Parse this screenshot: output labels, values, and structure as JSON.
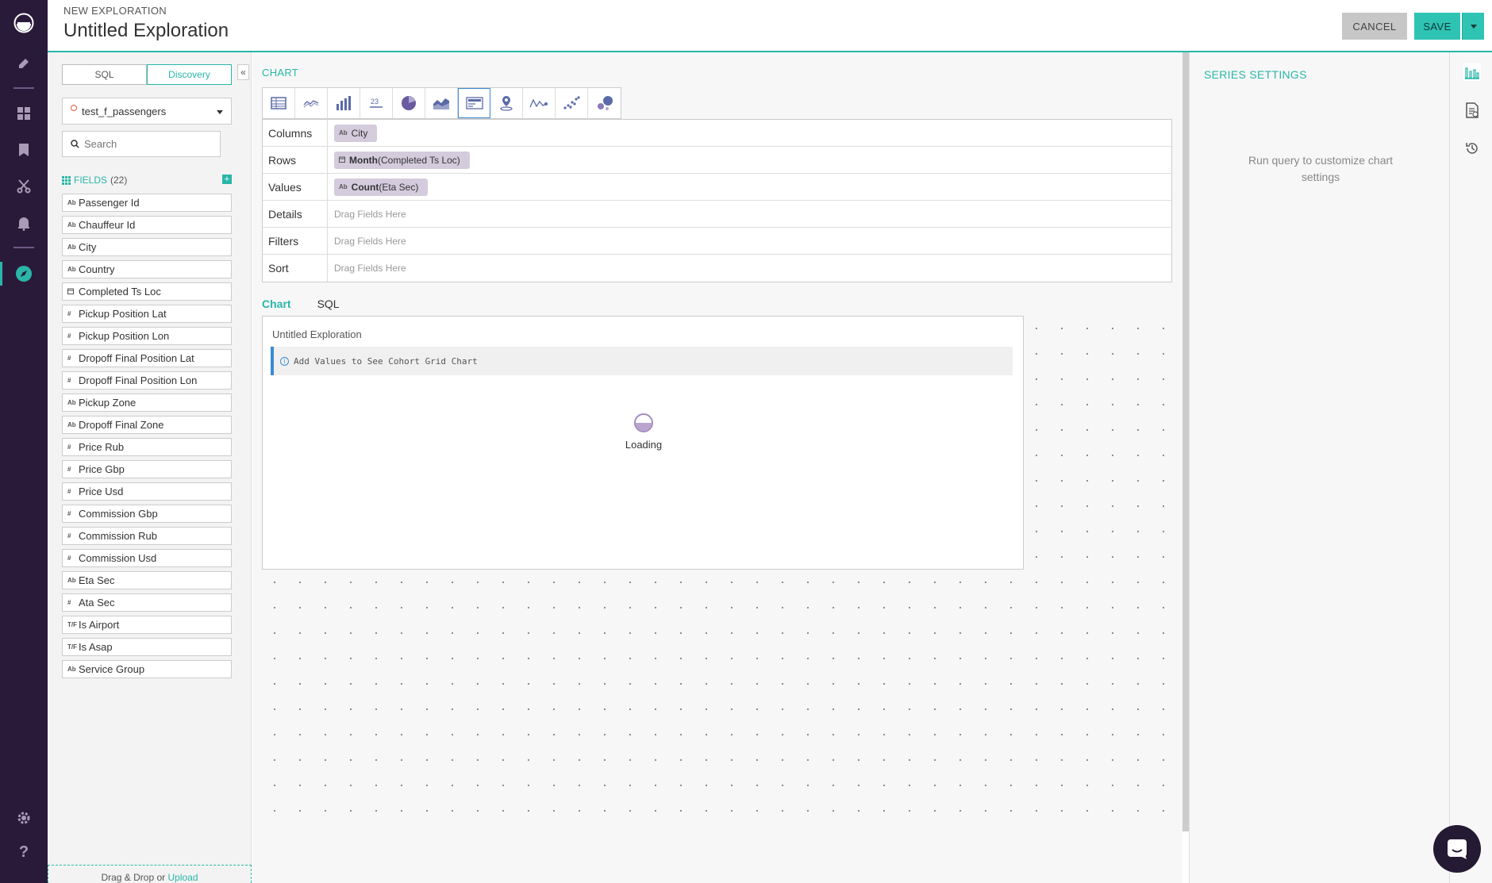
{
  "header": {
    "subtitle": "NEW EXPLORATION",
    "title": "Untitled Exploration",
    "cancel_label": "CANCEL",
    "save_label": "SAVE"
  },
  "left_panel": {
    "mode_tabs": [
      "SQL",
      "Discovery"
    ],
    "active_mode": "Discovery",
    "data_source": "test_f_passengers",
    "search_placeholder": "Search",
    "fields_label": "FIELDS",
    "fields_count": "(22)",
    "fields": [
      {
        "type": "Ab",
        "name": "Passenger Id"
      },
      {
        "type": "Ab",
        "name": "Chauffeur Id"
      },
      {
        "type": "Ab",
        "name": "City"
      },
      {
        "type": "Ab",
        "name": "Country"
      },
      {
        "type": "cal",
        "name": "Completed Ts Loc"
      },
      {
        "type": "#",
        "name": "Pickup Position Lat"
      },
      {
        "type": "#",
        "name": "Pickup Position Lon"
      },
      {
        "type": "#",
        "name": "Dropoff Final Position Lat"
      },
      {
        "type": "#",
        "name": "Dropoff Final Position Lon"
      },
      {
        "type": "Ab",
        "name": "Pickup Zone"
      },
      {
        "type": "Ab",
        "name": "Dropoff Final Zone"
      },
      {
        "type": "#",
        "name": "Price Rub"
      },
      {
        "type": "#",
        "name": "Price Gbp"
      },
      {
        "type": "#",
        "name": "Price Usd"
      },
      {
        "type": "#",
        "name": "Commission Gbp"
      },
      {
        "type": "#",
        "name": "Commission Rub"
      },
      {
        "type": "#",
        "name": "Commission Usd"
      },
      {
        "type": "Ab",
        "name": "Eta Sec"
      },
      {
        "type": "#",
        "name": "Ata Sec"
      },
      {
        "type": "T/F",
        "name": "Is Airport"
      },
      {
        "type": "T/F",
        "name": "Is Asap"
      },
      {
        "type": "Ab",
        "name": "Service Group"
      }
    ],
    "upload_text": "Drag & Drop or",
    "upload_link": "Upload"
  },
  "center": {
    "chart_header": "CHART",
    "chart_types": [
      "table-icon",
      "line-icon",
      "bar-icon",
      "number-icon",
      "pie-icon",
      "area-icon",
      "cohort-grid-icon",
      "map-icon",
      "sparkline-icon",
      "scatter-icon",
      "bubble-icon"
    ],
    "active_chart_type": "cohort-grid-icon",
    "shelves": {
      "columns_label": "Columns",
      "columns_pill_type": "Ab",
      "columns_pill": "City",
      "rows_label": "Rows",
      "rows_pill_fn": "Month",
      "rows_pill_arg": "(Completed Ts Loc)",
      "values_label": "Values",
      "values_pill_type": "Ab",
      "values_pill_fn": "Count",
      "values_pill_arg": "(Eta Sec)",
      "details_label": "Details",
      "filters_label": "Filters",
      "sort_label": "Sort",
      "drop_hint": "Drag Fields Here"
    },
    "view_tabs": [
      "Chart",
      "SQL"
    ],
    "active_view": "Chart",
    "chart_title": "Untitled Exploration",
    "notice": "Add Values to See Cohort Grid Chart",
    "loading": "Loading"
  },
  "right_panel": {
    "header": "SERIES SETTINGS",
    "message": "Run query to customize chart settings"
  },
  "colors": {
    "accent": "#29b6a8",
    "rail": "#2a1a3a",
    "pill": "#d4cbdd",
    "info": "#3a8ad6"
  }
}
